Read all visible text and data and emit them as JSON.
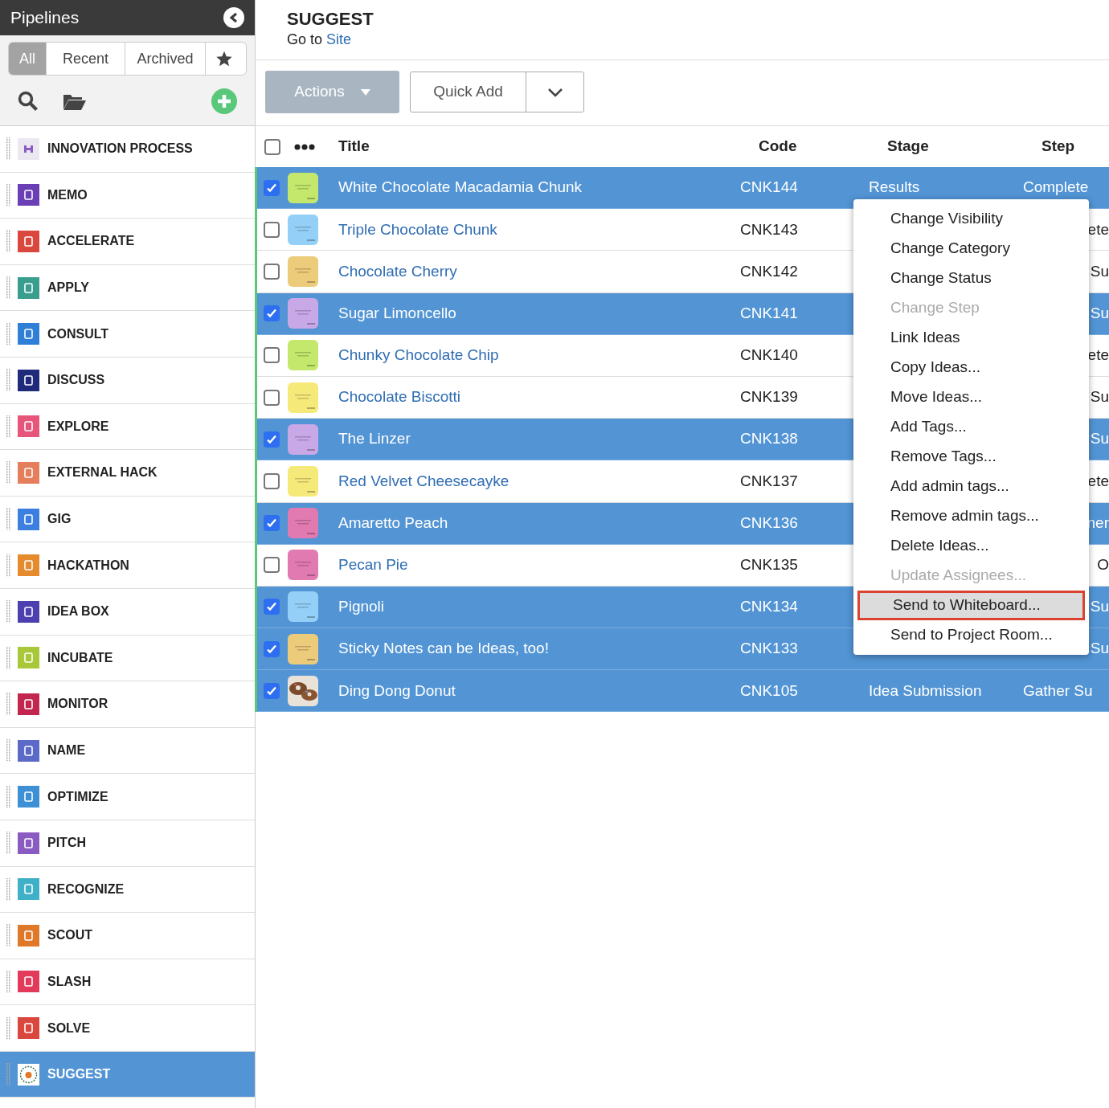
{
  "sidebar": {
    "title": "Pipelines",
    "tabs": [
      {
        "label": "All",
        "selected": true
      },
      {
        "label": "Recent",
        "selected": false
      },
      {
        "label": "Archived",
        "selected": false
      },
      {
        "kind": "star",
        "selected": false
      }
    ],
    "items": [
      {
        "label": "INNOVATION PROCESS",
        "color": "#ece8f2",
        "selected": false
      },
      {
        "label": "MEMO",
        "color": "#6a3fb5",
        "selected": false
      },
      {
        "label": "ACCELERATE",
        "color": "#d9473f",
        "selected": false
      },
      {
        "label": "APPLY",
        "color": "#3a9e8f",
        "selected": false
      },
      {
        "label": "CONSULT",
        "color": "#2f7fd6",
        "selected": false
      },
      {
        "label": "DISCUSS",
        "color": "#1f2a7a",
        "selected": false
      },
      {
        "label": "EXPLORE",
        "color": "#e8557a",
        "selected": false
      },
      {
        "label": "EXTERNAL HACK",
        "color": "#e57e5b",
        "selected": false
      },
      {
        "label": "GIG",
        "color": "#3b7fe0",
        "selected": false
      },
      {
        "label": "HACKATHON",
        "color": "#e58a2d",
        "selected": false
      },
      {
        "label": "IDEA BOX",
        "color": "#4c3fb0",
        "selected": false
      },
      {
        "label": "INCUBATE",
        "color": "#a8c83a",
        "selected": false
      },
      {
        "label": "MONITOR",
        "color": "#c2264f",
        "selected": false
      },
      {
        "label": "NAME",
        "color": "#5b6ac9",
        "selected": false
      },
      {
        "label": "OPTIMIZE",
        "color": "#3d8fd6",
        "selected": false
      },
      {
        "label": "PITCH",
        "color": "#8a5cc2",
        "selected": false
      },
      {
        "label": "RECOGNIZE",
        "color": "#3eb0c7",
        "selected": false
      },
      {
        "label": "SCOUT",
        "color": "#e0782a",
        "selected": false
      },
      {
        "label": "SLASH",
        "color": "#e23a5a",
        "selected": false
      },
      {
        "label": "SOLVE",
        "color": "#d9473f",
        "selected": false
      },
      {
        "label": "SUGGEST",
        "color": "#ffffff",
        "selected": true
      }
    ]
  },
  "header": {
    "title": "SUGGEST",
    "goto": "Go to",
    "link": "Site"
  },
  "toolbar": {
    "actions": "Actions",
    "quick_add": "Quick Add"
  },
  "table": {
    "select_all": {
      "checked": false
    },
    "columns": [
      "Title",
      "Code",
      "Stage",
      "Step"
    ],
    "rows": [
      {
        "selected": true,
        "kind": "note",
        "color": "#c4e86b",
        "title": "White Chocolate Macadamia Chunk",
        "code": "CNK144",
        "stage": "Results",
        "step": "Complete"
      },
      {
        "selected": false,
        "kind": "note",
        "color": "#93cff7",
        "title": "Triple Chocolate Chunk",
        "code": "CNK143",
        "step": "ete"
      },
      {
        "selected": false,
        "kind": "note",
        "color": "#eccb7a",
        "title": "Chocolate Cherry",
        "code": "CNK142",
        "step": "Su"
      },
      {
        "selected": true,
        "kind": "note",
        "color": "#c8a8e6",
        "title": "Sugar Limoncello",
        "code": "CNK141",
        "step": "Su"
      },
      {
        "selected": false,
        "kind": "note",
        "color": "#c4e86b",
        "title": "Chunky Chocolate Chip",
        "code": "CNK140",
        "step": "ete"
      },
      {
        "selected": false,
        "kind": "note",
        "color": "#f5e97a",
        "title": "Chocolate Biscotti",
        "code": "CNK139",
        "step": "Su"
      },
      {
        "selected": true,
        "kind": "note",
        "color": "#c8a8e6",
        "title": "The Linzer",
        "code": "CNK138",
        "step": "Su"
      },
      {
        "selected": false,
        "kind": "note",
        "color": "#f5e97a",
        "title": "Red Velvet Cheesecayke",
        "code": "CNK137",
        "step": "ete"
      },
      {
        "selected": true,
        "kind": "note",
        "color": "#e07ab0",
        "title": "Amaretto Peach",
        "code": "CNK136",
        "step": "ner"
      },
      {
        "selected": false,
        "kind": "note",
        "color": "#e07ab0",
        "title": "Pecan Pie",
        "code": "CNK135",
        "step": "O"
      },
      {
        "selected": true,
        "kind": "note",
        "color": "#93cff7",
        "title": "Pignoli",
        "code": "CNK134",
        "step": "Su"
      },
      {
        "selected": true,
        "kind": "note",
        "color": "#eccb7a",
        "title": "Sticky Notes can be Ideas, too!",
        "code": "CNK133",
        "step": "Su"
      },
      {
        "selected": true,
        "kind": "picture",
        "title": "Ding Dong Donut",
        "code": "CNK105",
        "stage": "Idea Submission",
        "step": "Gather Su"
      }
    ]
  },
  "menu": [
    {
      "label": "Change Visibility",
      "disabled": false,
      "selected": false
    },
    {
      "label": "Change Category",
      "disabled": false,
      "selected": false
    },
    {
      "label": "Change Status",
      "disabled": false,
      "selected": false
    },
    {
      "label": "Change Step",
      "disabled": true,
      "selected": false
    },
    {
      "label": "Link Ideas",
      "disabled": false,
      "selected": false
    },
    {
      "label": "Copy Ideas...",
      "disabled": false,
      "selected": false
    },
    {
      "label": "Move Ideas...",
      "disabled": false,
      "selected": false
    },
    {
      "label": "Add Tags...",
      "disabled": false,
      "selected": false
    },
    {
      "label": "Remove Tags...",
      "disabled": false,
      "selected": false
    },
    {
      "label": "Add admin tags...",
      "disabled": false,
      "selected": false
    },
    {
      "label": "Remove admin tags...",
      "disabled": false,
      "selected": false
    },
    {
      "label": "Delete Ideas...",
      "disabled": false,
      "selected": false
    },
    {
      "label": "Update Assignees...",
      "disabled": true,
      "selected": false
    },
    {
      "label": "Send to Whiteboard...",
      "disabled": false,
      "selected": true
    },
    {
      "label": "Send to Project Room...",
      "disabled": false,
      "selected": false
    }
  ]
}
